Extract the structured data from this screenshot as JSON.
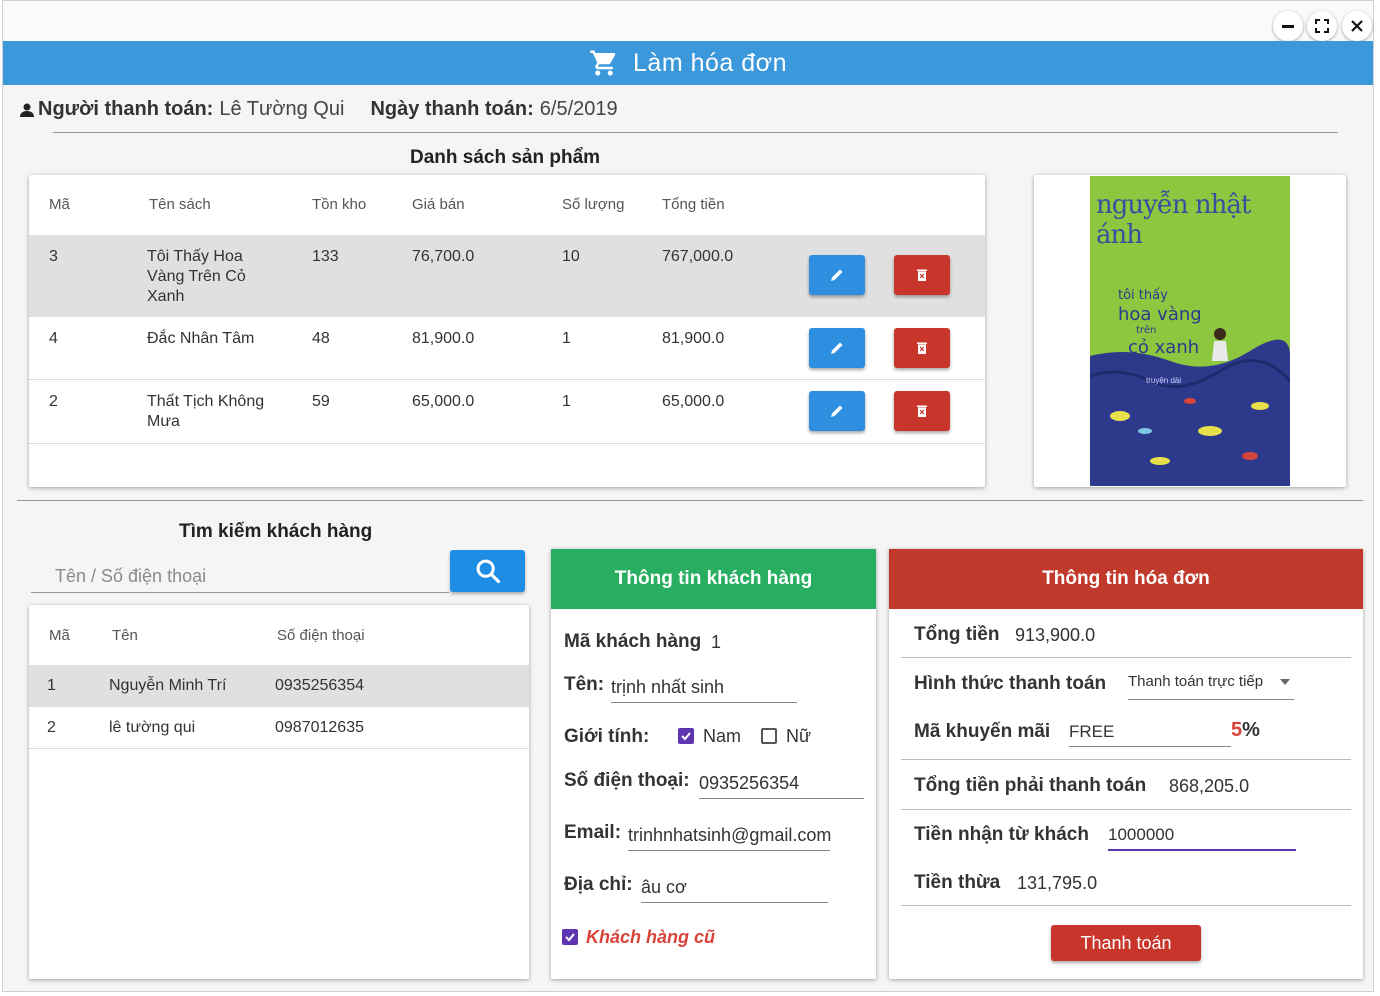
{
  "window": {
    "title": "Làm hóa đơn",
    "controls": [
      "minimize-icon",
      "maximize-icon",
      "close-icon"
    ]
  },
  "payer": {
    "label": "Người thanh toán:",
    "name": "Lê Tường Qui",
    "date_label": "Ngày thanh toán:",
    "date": "6/5/2019"
  },
  "products": {
    "title": "Danh sách sản phẩm",
    "columns": [
      "Mã",
      "Tên sách",
      "Tồn kho",
      "Giá bán",
      "Số lượng",
      "Tổng tiền"
    ],
    "rows": [
      {
        "id": "3",
        "name": "Tôi Thấy Hoa Vàng Trên Cỏ Xanh",
        "stock": "133",
        "price": "76,700.0",
        "qty": "10",
        "total": "767,000.0"
      },
      {
        "id": "4",
        "name": "Đắc Nhân Tâm",
        "stock": "48",
        "price": "81,900.0",
        "qty": "1",
        "total": "81,900.0"
      },
      {
        "id": "2",
        "name": "Thất Tịch Không Mưa",
        "stock": "59",
        "price": "65,000.0",
        "qty": "1",
        "total": "65,000.0"
      }
    ],
    "selected_index": 0
  },
  "book_cover": {
    "author": "nguyễn nhật ánh",
    "title_lines": [
      "tôi thấy",
      "hoa vàng",
      "trên",
      "cỏ xanh"
    ],
    "subtitle": "truyện dài",
    "bg_top": "#8dc63f",
    "bg_bottom": "#2d3a8c"
  },
  "customer_search": {
    "title": "Tìm kiếm khách hàng",
    "placeholder": "Tên / Số điện thoại",
    "columns": [
      "Mã",
      "Tên",
      "Số điện thoại"
    ],
    "rows": [
      {
        "id": "1",
        "name": "Nguyễn Minh Trí",
        "phone": "0935256354"
      },
      {
        "id": "2",
        "name": "lê tường qui",
        "phone": "0987012635"
      }
    ],
    "selected_index": 0
  },
  "customer_info": {
    "title": "Thông tin khách hàng",
    "id_label": "Mã khách hàng",
    "id": "1",
    "name_label": "Tên:",
    "name": "trịnh nhất sinh",
    "gender_label": "Giới tính:",
    "male_label": "Nam",
    "male_checked": true,
    "female_label": "Nữ",
    "female_checked": false,
    "phone_label": "Số điện thoại:",
    "phone": "0935256354",
    "email_label": "Email:",
    "email": "trinhnhatsinh@gmail.com",
    "address_label": "Địa chỉ:",
    "address": "âu cơ",
    "returning_label": "Khách hàng cũ",
    "returning_checked": true
  },
  "invoice": {
    "title": "Thông tin hóa đơn",
    "total_label": "Tổng tiền",
    "total": "913,900.0",
    "method_label": "Hình thức thanh toán",
    "method": "Thanh toán trực tiếp",
    "promo_label": "Mã khuyến mãi",
    "promo_code": "FREE",
    "promo_percent": "5",
    "promo_suffix": "%",
    "due_label": "Tổng tiền phải thanh toán",
    "due": "868,205.0",
    "received_label": "Tiền nhận từ khách",
    "received": "1000000",
    "change_label": "Tiền thừa",
    "change": "131,795.0",
    "pay_button": "Thanh toán"
  },
  "colors": {
    "header": "#3a98db",
    "customer_panel": "#27ae60",
    "invoice_panel": "#c0392b",
    "edit_button": "#2e8fe0",
    "delete_button": "#c8352b",
    "checkbox": "#5e35b1"
  }
}
